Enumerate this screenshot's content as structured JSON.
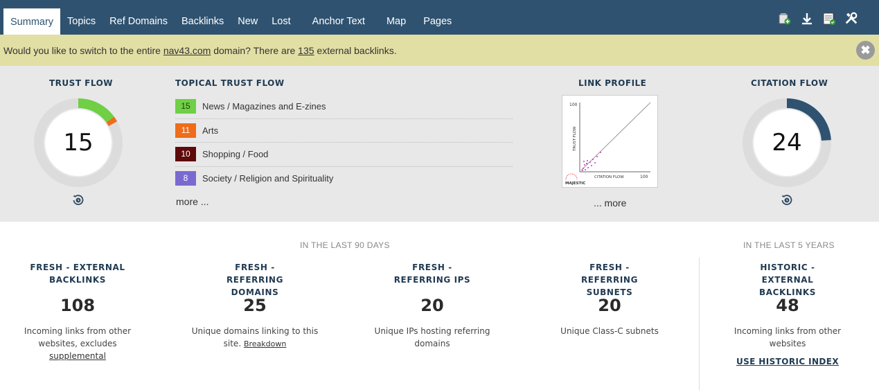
{
  "nav": {
    "tabs": [
      "Summary",
      "Topics",
      "Ref Domains",
      "Backlinks",
      "New",
      "Lost",
      "Anchor Text",
      "Map",
      "Pages"
    ],
    "active_tab": "Summary",
    "tools": [
      "add-to-bucket-icon",
      "download-icon",
      "report-icon",
      "tools-icon"
    ]
  },
  "banner": {
    "text_before": "Would you like to switch to the entire ",
    "domain_link": "nav43.com",
    "text_middle": " domain? There are ",
    "count_link": "135",
    "text_after": " external backlinks.",
    "close_label": "✖"
  },
  "trust_flow": {
    "title": "TRUST FLOW",
    "value": "15",
    "score": 15,
    "colors": [
      "#6fcf45",
      "#ef6c1a"
    ],
    "ring_color": "#dcdcdc"
  },
  "topical_trust_flow": {
    "title": "TOPICAL TRUST FLOW",
    "items": [
      {
        "score": "15",
        "label": "News / Magazines and E-zines",
        "color": "#6fcf45",
        "text_color": "#1e3d0e"
      },
      {
        "score": "11",
        "label": "Arts",
        "color": "#ef6c1a",
        "text_color": "#ffffff"
      },
      {
        "score": "10",
        "label": "Shopping / Food",
        "color": "#5e0a0a",
        "text_color": "#ffffff"
      },
      {
        "score": "8",
        "label": "Society / Religion and Spirituality",
        "color": "#7a6ad0",
        "text_color": "#ffffff"
      }
    ],
    "more": "more ..."
  },
  "link_profile": {
    "title": "LINK PROFILE",
    "y_axis": "TRUST FLOW",
    "x_axis": "CITATION FLOW",
    "y_max": "100",
    "x_max": "100",
    "logo": "MAJESTIC",
    "more": "... more"
  },
  "citation_flow": {
    "title": "CITATION FLOW",
    "value": "24",
    "score": 24,
    "color": "#2f5270",
    "ring_color": "#dcdcdc"
  },
  "periods": {
    "recent": "IN THE LAST 90 DAYS",
    "historic": "IN THE LAST 5 YEARS"
  },
  "stats": [
    {
      "title": "FRESH - EXTERNAL BACKLINKS",
      "value": "108",
      "desc": "Incoming links from other websites, excludes ",
      "link": "supplemental"
    },
    {
      "title": "FRESH - REFERRING DOMAINS",
      "value": "25",
      "desc": "Unique domains linking to this site. ",
      "link": "Breakdown"
    },
    {
      "title": "FRESH - REFERRING IPS",
      "value": "20",
      "desc": "Unique IPs hosting referring domains",
      "link": ""
    },
    {
      "title": "FRESH - REFERRING SUBNETS",
      "value": "20",
      "desc": "Unique Class-C subnets",
      "link": ""
    },
    {
      "title": "HISTORIC - EXTERNAL BACKLINKS",
      "value": "48",
      "desc": "Incoming links from other websites",
      "link": "USE HISTORIC INDEX"
    }
  ]
}
